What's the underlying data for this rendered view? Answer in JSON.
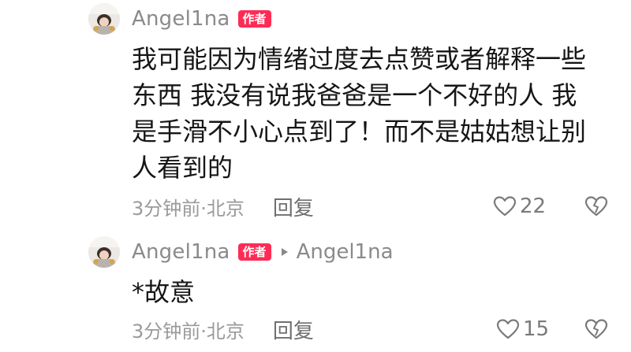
{
  "comments": [
    {
      "username": "Angel1na",
      "badge": "作者",
      "text": "我可能因为情绪过度去点赞或者解释一些东西 我没有说我爸爸是一个不好的人 我是手滑不小心点到了！而不是姑姑想让别人看到的",
      "meta": "3分钟前·北京",
      "reply_label": "回复",
      "likes": "22"
    },
    {
      "username": "Angel1na",
      "badge": "作者",
      "reply_to": "Angel1na",
      "text": "*故意",
      "meta": "3分钟前·北京",
      "reply_label": "回复",
      "likes": "15"
    }
  ],
  "icons": {
    "heart": "heart-icon",
    "dislike": "broken-heart-icon",
    "reply_arrow": "play-triangle-icon"
  },
  "colors": {
    "badge": "#fe2c55",
    "username": "#8a8a8a",
    "meta": "#9a9a9a"
  }
}
